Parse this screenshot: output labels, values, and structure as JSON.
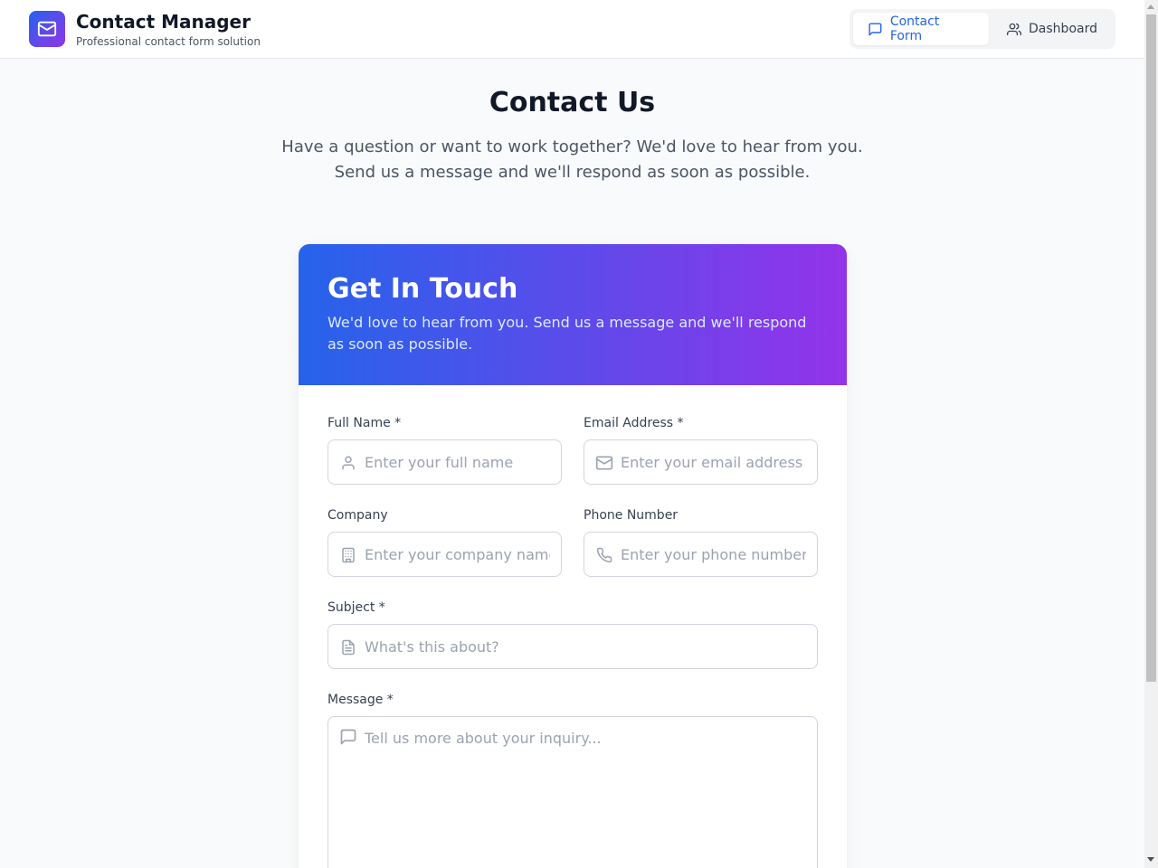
{
  "header": {
    "app_title": "Contact Manager",
    "app_subtitle": "Professional contact form solution",
    "logo_icon": "mail-icon",
    "nav": [
      {
        "label": "Contact Form",
        "icon": "message-icon",
        "active": true
      },
      {
        "label": "Dashboard",
        "icon": "users-icon",
        "active": false
      }
    ]
  },
  "hero": {
    "title": "Contact Us",
    "description": "Have a question or want to work together? We'd love to hear from you. Send us a message and we'll respond as soon as possible."
  },
  "card": {
    "title": "Get In Touch",
    "description": "We'd love to hear from you. Send us a message and we'll respond as soon as possible."
  },
  "form": {
    "full_name": {
      "label": "Full Name *",
      "placeholder": "Enter your full name",
      "value": "",
      "icon": "user-icon"
    },
    "email": {
      "label": "Email Address *",
      "placeholder": "Enter your email address",
      "value": "",
      "icon": "mail-icon"
    },
    "company": {
      "label": "Company",
      "placeholder": "Enter your company name",
      "value": "",
      "icon": "building-icon"
    },
    "phone": {
      "label": "Phone Number",
      "placeholder": "Enter your phone number",
      "value": "",
      "icon": "phone-icon"
    },
    "subject": {
      "label": "Subject *",
      "placeholder": "What's this about?",
      "value": "",
      "icon": "file-text-icon"
    },
    "message": {
      "label": "Message *",
      "placeholder": "Tell us more about your inquiry...",
      "value": "",
      "icon": "message-icon"
    }
  },
  "colors": {
    "accent": "#2563eb",
    "gradient_start": "#2563eb",
    "gradient_end": "#9333ea",
    "background": "#f9fafb"
  }
}
